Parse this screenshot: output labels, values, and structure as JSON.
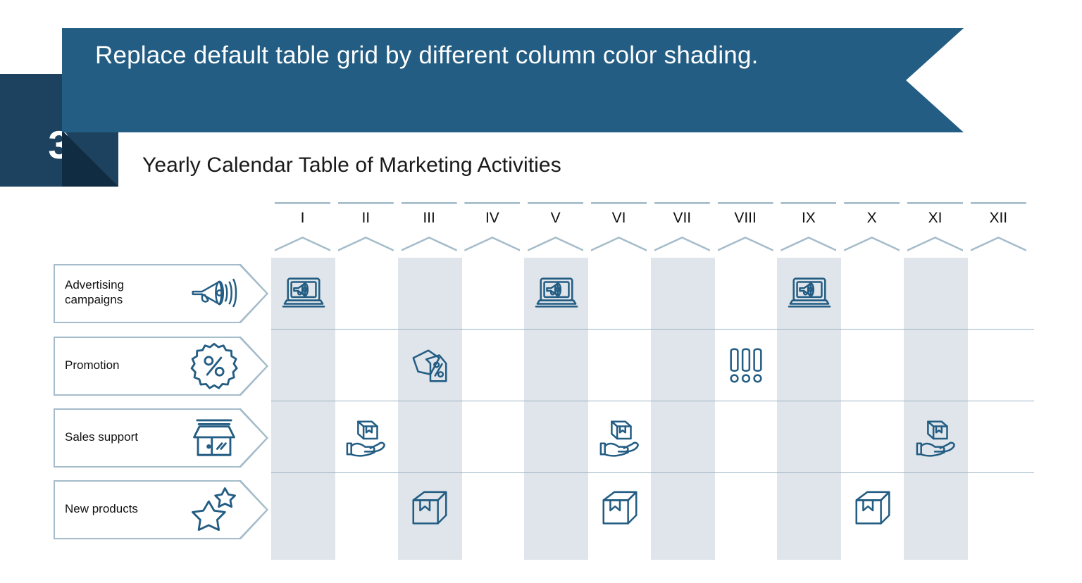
{
  "slide": {
    "step_number": "3",
    "banner_title": "Replace default table grid by different column color shading.",
    "subtitle": "Yearly Calendar Table of Marketing Activities",
    "colors": {
      "banner_blue": "#235d83",
      "number_navy": "#1d4260",
      "shadow_navy": "#102c42",
      "shade_band": "#dfe5ea",
      "outline_blue": "#a5bcca",
      "icon_blue": "#235d83",
      "text_dark": "#111111"
    }
  },
  "table": {
    "column_headers": [
      "I",
      "II",
      "III",
      "IV",
      "V",
      "VI",
      "VII",
      "VIII",
      "IX",
      "X",
      "XI",
      "XII"
    ],
    "shaded_columns": [
      1,
      3,
      5,
      7,
      9,
      11
    ],
    "rows": [
      {
        "label": "Advertising campaigns",
        "label_line1": "Advertising",
        "label_line2": "campaigns",
        "icon": "megaphone-icon",
        "cell_icon": "laptop-megaphone-icon",
        "active_months": [
          1,
          5,
          9
        ]
      },
      {
        "label": "Promotion",
        "label_line1": "Promotion",
        "label_line2": "",
        "icon": "percent-badge-icon",
        "cell_icon": "price-tags-percent-icon",
        "active_months": [
          3,
          8
        ],
        "alt_cell_icons": {
          "8": "exclamation-marks-icon"
        }
      },
      {
        "label": "Sales support",
        "label_line1": "Sales support",
        "label_line2": "",
        "icon": "storefront-icon",
        "cell_icon": "hand-holding-box-icon",
        "active_months": [
          2,
          6,
          11
        ]
      },
      {
        "label": "New products",
        "label_line1": "New products",
        "label_line2": "",
        "icon": "stars-icon",
        "cell_icon": "box-icon",
        "active_months": [
          3,
          6,
          10
        ]
      }
    ]
  }
}
